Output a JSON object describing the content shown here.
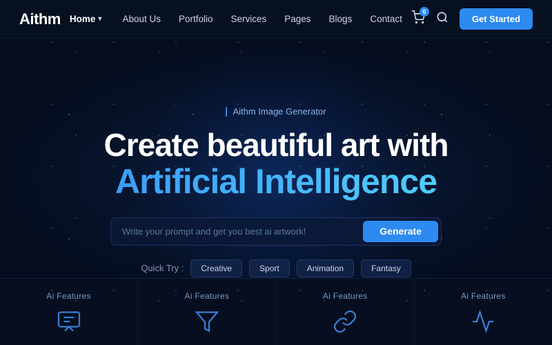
{
  "brand": {
    "name": "Aithm"
  },
  "nav": {
    "links": [
      {
        "id": "home",
        "label": "Home",
        "active": true,
        "hasDropdown": true
      },
      {
        "id": "about",
        "label": "About Us",
        "active": false,
        "hasDropdown": false
      },
      {
        "id": "portfolio",
        "label": "Portfolio",
        "active": false,
        "hasDropdown": false
      },
      {
        "id": "services",
        "label": "Services",
        "active": false,
        "hasDropdown": false
      },
      {
        "id": "pages",
        "label": "Pages",
        "active": false,
        "hasDropdown": false
      },
      {
        "id": "blogs",
        "label": "Blogs",
        "active": false,
        "hasDropdown": false
      },
      {
        "id": "contact",
        "label": "Contact",
        "active": false,
        "hasDropdown": false
      }
    ],
    "cart_count": "0",
    "get_started_label": "Get Started"
  },
  "hero": {
    "label": "Aithm Image Generator",
    "title_line1": "Create beautiful art with",
    "title_line2": "Artificial Intelligence",
    "search_placeholder": "Write your prompt and get you best ai artwork!",
    "generate_label": "Generate",
    "quick_try_label": "Quick Try :",
    "quick_tags": [
      {
        "id": "creative",
        "label": "Creative"
      },
      {
        "id": "sport",
        "label": "Sport"
      },
      {
        "id": "animation",
        "label": "Animation"
      },
      {
        "id": "fantasy",
        "label": "Fantasy"
      }
    ]
  },
  "features": [
    {
      "id": "f1",
      "label": "Ai Features",
      "icon": "chat-icon"
    },
    {
      "id": "f2",
      "label": "Ai Features",
      "icon": "filter-icon"
    },
    {
      "id": "f3",
      "label": "Ai Features",
      "icon": "link-icon"
    },
    {
      "id": "f4",
      "label": "Ai Features",
      "icon": "chart-icon"
    }
  ]
}
